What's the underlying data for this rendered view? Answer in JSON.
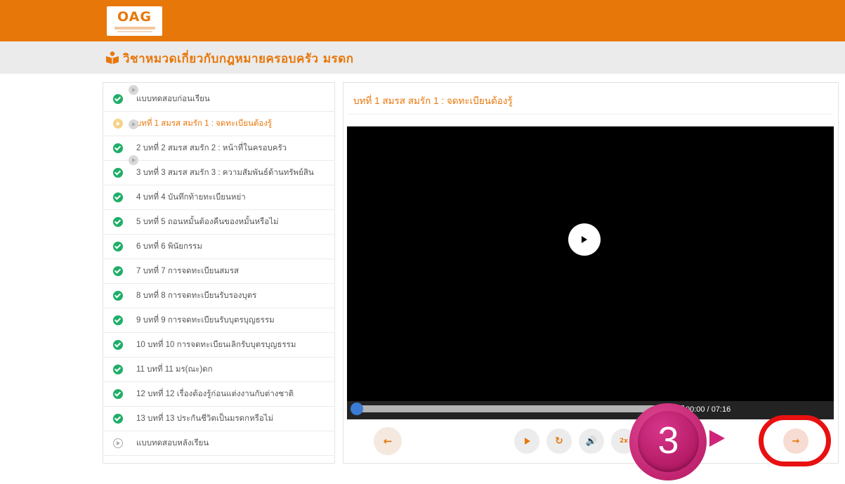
{
  "header": {
    "logo_text": "OAG",
    "brand_color": "#e8770a"
  },
  "page": {
    "title": "วิชาหมวดเกี่ยวกับกฎหมายครอบครัว มรดก",
    "title_icon": "book-reader-icon"
  },
  "lessons": [
    {
      "label": "แบบทดสอบก่อนเรียน",
      "status": "done"
    },
    {
      "label": "บทที่ 1 สมรส สมรัก 1 : จดทะเบียนต้องรู้",
      "status": "current"
    },
    {
      "label": "2 บทที่ 2 สมรส สมรัก 2 : หน้าที่ในครอบครัว",
      "status": "done"
    },
    {
      "label": "3 บทที่ 3 สมรส สมรัก 3 : ความสัมพันธ์ด้านทรัพย์สิน",
      "status": "done"
    },
    {
      "label": "4 บทที่ 4 บันทึกท้ายทะเบียนหย่า",
      "status": "done"
    },
    {
      "label": "5 บทที่ 5 ถอนหมั้นต้องคืนของหมั้นหรือไม่",
      "status": "done"
    },
    {
      "label": "6 บทที่ 6 พินัยกรรม",
      "status": "done"
    },
    {
      "label": "7 บทที่ 7 การจดทะเบียนสมรส",
      "status": "done"
    },
    {
      "label": "8 บทที่ 8 การจดทะเบียนรับรองบุตร",
      "status": "done"
    },
    {
      "label": "9 บทที่ 9 การจดทะเบียนรับบุตรบุญธรรม",
      "status": "done"
    },
    {
      "label": "10 บทที่ 10 การจดทะเบียนเลิกรับบุตรบุญธรรม",
      "status": "done"
    },
    {
      "label": "11 บทที่ 11 มร(ณะ)ดก",
      "status": "done"
    },
    {
      "label": "12 บทที่ 12 เรื่องต้องรู้ก่อนแต่งงานกับต่างชาติ",
      "status": "done"
    },
    {
      "label": "13 บทที่ 13 ประกันชีวิตเป็นมรดกหรือไม่",
      "status": "done"
    },
    {
      "label": "แบบทดสอบหลังเรียน",
      "status": "pending"
    }
  ],
  "player": {
    "lesson_title": "บทที่ 1 สมรส สมรัก 1 : จดทะเบียนต้องรู้",
    "time": "00:00 / 07:16",
    "progress": 0,
    "speed_label": "2x"
  },
  "controls": {
    "prev_icon": "arrow-left-icon",
    "next_icon": "arrow-right-icon",
    "prev_symbol": "←",
    "next_symbol": "→",
    "replay_symbol": "↻",
    "volume_symbol": "🔊"
  },
  "step_badge": {
    "number": "3",
    "color": "#d0247a"
  }
}
